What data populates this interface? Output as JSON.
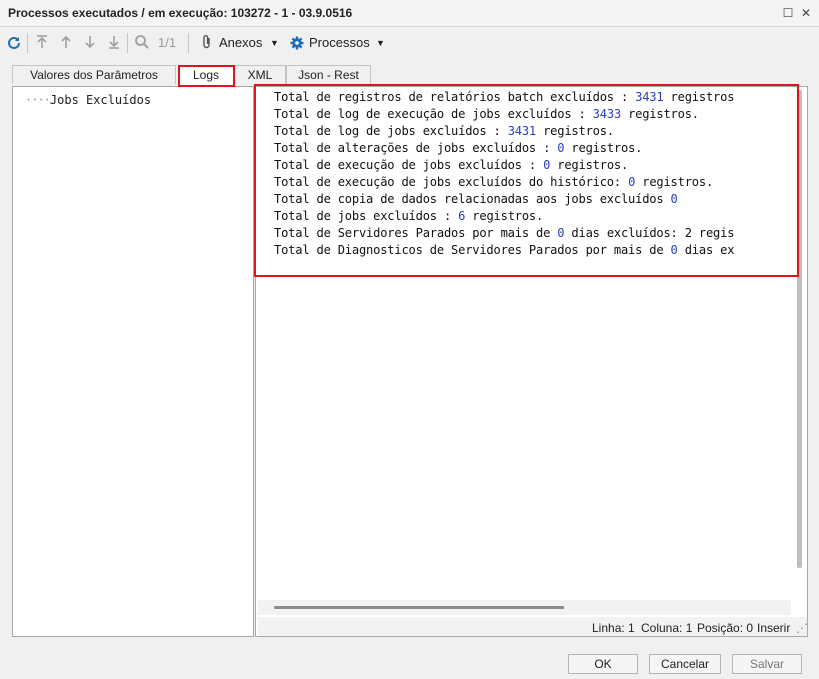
{
  "window": {
    "title": "Processos executados / em execução: 103272 - 1 - 03.9.0516",
    "maximize_glyph": "☐",
    "close_glyph": "✕"
  },
  "toolbar": {
    "refresh_icon": "refresh-icon",
    "pagination": "1/1",
    "anexos_label": "Anexos",
    "processos_label": "Processos",
    "dropdown_glyph": "▼"
  },
  "tabs": [
    {
      "label": "Valores dos Parâmetros"
    },
    {
      "label": "Logs"
    },
    {
      "label": "XML"
    },
    {
      "label": "Json - Rest"
    }
  ],
  "tree": {
    "connector": "····",
    "item": "Jobs Excluídos"
  },
  "log": {
    "lines": [
      {
        "pre": "Total de registros de relatórios batch excluídos : ",
        "num": "3431",
        "post": " registros"
      },
      {
        "pre": "Total de log de execução de jobs excluídos : ",
        "num": "3433",
        "post": " registros."
      },
      {
        "pre": "Total de log de jobs excluídos : ",
        "num": "3431",
        "post": " registros."
      },
      {
        "pre": "Total de alterações de jobs excluídos : ",
        "num": "0",
        "post": " registros."
      },
      {
        "pre": "Total de execução de jobs excluídos : ",
        "num": "0",
        "post": " registros."
      },
      {
        "pre": "Total de execução de jobs excluídos do histórico: ",
        "num": "0",
        "post": " registros."
      },
      {
        "pre": "Total de copia de dados relacionadas aos jobs excluídos ",
        "num": "0",
        "post": ""
      },
      {
        "pre": "Total de jobs excluídos : ",
        "num": "6",
        "post": " registros."
      },
      {
        "pre": "Total de Servidores Parados por mais de ",
        "num": "0",
        "post": " dias excluídos: 2 regis"
      },
      {
        "pre": "Total de Diagnosticos de Servidores Parados por mais de ",
        "num": "0",
        "post": " dias ex"
      }
    ]
  },
  "status": {
    "linha": "Linha: 1",
    "coluna": "Coluna: 1",
    "posicao": "Posição: 0",
    "modo": "Inserir"
  },
  "buttons": {
    "ok": "OK",
    "cancel": "Cancelar",
    "save": "Salvar"
  },
  "colors": {
    "highlight": "#e0121b",
    "number": "#2a3fc2",
    "refresh": "#1f6fb8",
    "gear": "#1f6fb8"
  }
}
